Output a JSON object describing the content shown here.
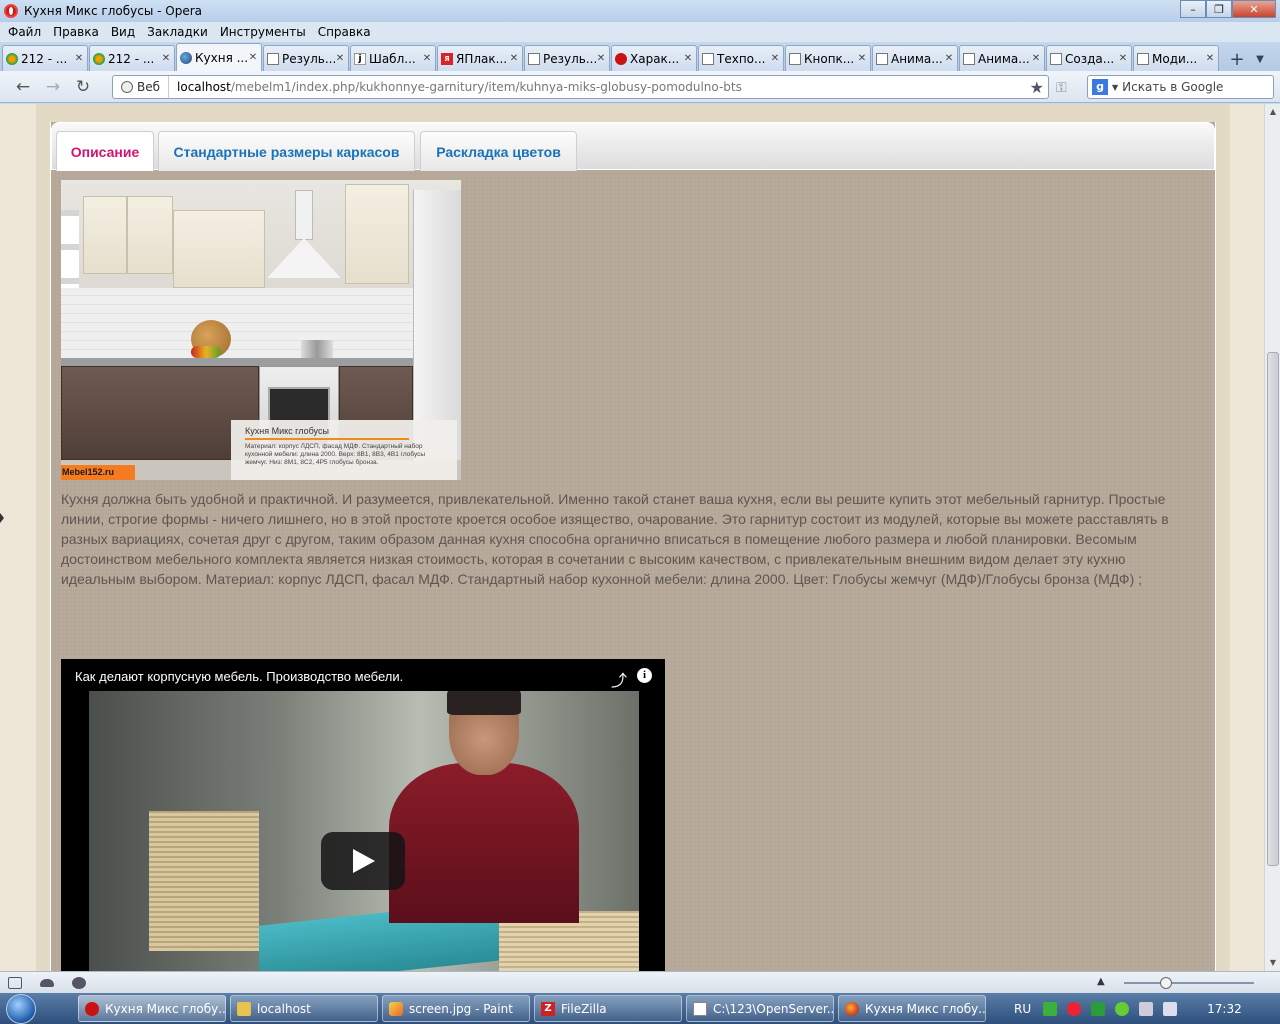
{
  "window": {
    "title": "Кухня Микс глобусы - Opera",
    "minimize": "–",
    "maximize": "❐",
    "close": "✕"
  },
  "menu": [
    "Файл",
    "Правка",
    "Вид",
    "Закладки",
    "Инструменты",
    "Справка"
  ],
  "tabs": [
    {
      "label": "212 - ...",
      "icon": "joomla-icon"
    },
    {
      "label": "212 - ...",
      "icon": "joomla-icon"
    },
    {
      "label": "Кухня ...",
      "icon": "globe-icon",
      "active": true
    },
    {
      "label": "Резуль...",
      "icon": "document-icon"
    },
    {
      "label": "Шабл...",
      "icon": "j-icon"
    },
    {
      "label": "ЯПлак...",
      "icon": "yandex-icon"
    },
    {
      "label": "Резуль...",
      "icon": "document-icon"
    },
    {
      "label": "Харак...",
      "icon": "opera-icon"
    },
    {
      "label": "Техпо...",
      "icon": "document-icon"
    },
    {
      "label": "Кнопк...",
      "icon": "document-icon"
    },
    {
      "label": "Анима...",
      "icon": "document-icon"
    },
    {
      "label": "Анима...",
      "icon": "document-icon"
    },
    {
      "label": "Созда...",
      "icon": "document-icon"
    },
    {
      "label": "Моди...",
      "icon": "document-icon"
    }
  ],
  "address": {
    "web_label": "Веб",
    "host": "localhost",
    "path": "/mebelm1/index.php/kukhonnye-garnitury/item/kuhnya-miks-globusy-pomodulno-bts"
  },
  "search": {
    "placeholder": "Искать в Google",
    "engine_letter": "g"
  },
  "page": {
    "tabs": [
      {
        "label": "Описание",
        "active": true
      },
      {
        "label": "Стандартные размеры каркасов",
        "active": false
      },
      {
        "label": "Раскладка цветов",
        "active": false
      }
    ],
    "image": {
      "caption_title": "Кухня Микс глобусы",
      "caption_text": "Материал: корпус ЛДСП, фасад МДФ. Стандартный набор кухонной мебели: длина 2000. Верх: 8В1, 8В3, 4В1 глобусы жемчуг. Низ: 8М1, 8С2, 4Р5 глобусы бронза.",
      "brand": "Mebel152.ru"
    },
    "description": "Кухня должна быть удобной и практичной. И разумеется, привлекательной. Именно такой станет ваша кухня, если вы решите купить этот мебельный гарнитур. Простые линии, строгие формы - ничего лишнего, но в этой простоте кроется особое изящество, очарование. Это гарнитур состоит из модулей, которые вы можете расставлять в разных вариациях, сочетая друг с другом, таким образом данная кухня способна органично вписаться в помещение любого размера и любой планировки. Весомым достоинством мебельного комплекта является низкая стоимость, которая в сочетании с высоким качеством, с привлекательным внешним видом делает эту кухню идеальным выбором. Материал: корпус ЛДСП, фасал МДФ. Стандартный набор кухонной мебели: длина 2000. Цвет: Глобусы жемчуг (МДФ)/Глобусы бронза (МДФ) ;",
    "video": {
      "title": "Как делают корпусную мебель. Производство мебели."
    }
  },
  "taskbar": {
    "items": [
      {
        "label": "Кухня Микс глобу...",
        "icon": "opera-icon",
        "active": true
      },
      {
        "label": "localhost",
        "icon": "folder-icon"
      },
      {
        "label": "screen.jpg - Paint",
        "icon": "paint-icon"
      },
      {
        "label": "FileZilla",
        "icon": "filezilla-icon"
      },
      {
        "label": "C:\\123\\OpenServer...",
        "icon": "notepad-icon"
      },
      {
        "label": "Кухня Микс глобу...",
        "icon": "firefox-icon"
      }
    ],
    "lang": "RU",
    "clock": "17:32"
  },
  "colors": {
    "tab_active": "#d0156f",
    "tab_link": "#1a73b8",
    "content_bg": "#b5a898"
  }
}
